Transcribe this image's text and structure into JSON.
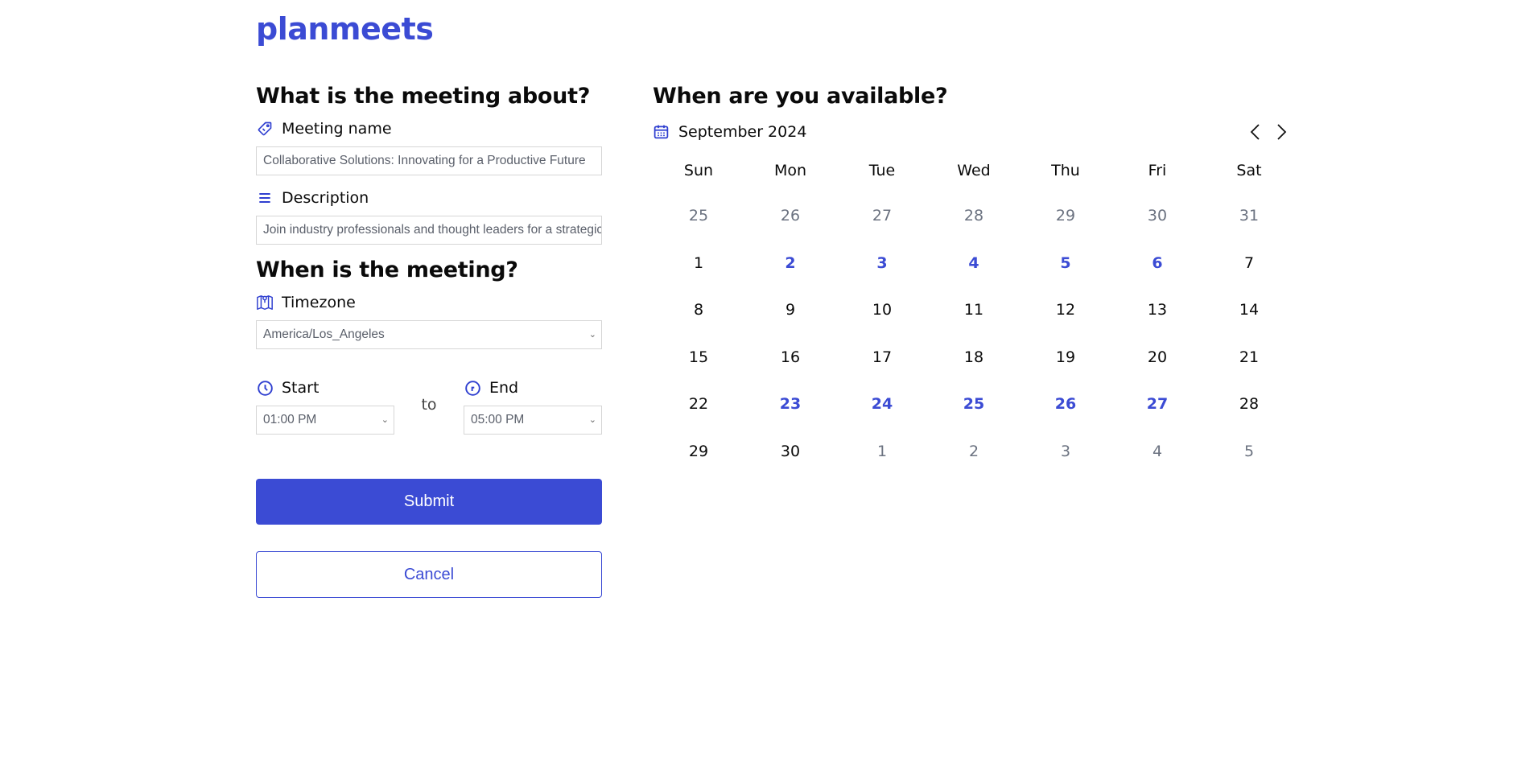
{
  "brand": "planmeets",
  "colors": {
    "accent": "#3b4bd4",
    "muted": "#6b7280",
    "border": "#d6d6d6"
  },
  "about": {
    "title": "What is the meeting about?",
    "meeting_name": {
      "label": "Meeting name",
      "icon": "tag-icon",
      "value": "Collaborative Solutions: Innovating for a Productive Future"
    },
    "description": {
      "label": "Description",
      "icon": "menu-lines-icon",
      "value": "Join industry professionals and thought leaders for a strategic"
    }
  },
  "when": {
    "title": "When is the meeting?",
    "timezone": {
      "label": "Timezone",
      "icon": "map-pin-icon",
      "value": "America/Los_Angeles"
    },
    "start": {
      "label": "Start",
      "icon": "clock-icon",
      "value": "01:00 PM"
    },
    "separator": "to",
    "end": {
      "label": "End",
      "icon": "clock-icon",
      "value": "05:00 PM"
    }
  },
  "actions": {
    "submit": "Submit",
    "cancel": "Cancel"
  },
  "availability": {
    "title": "When are you available?",
    "month_label": "September 2024",
    "weekdays": [
      "Sun",
      "Mon",
      "Tue",
      "Wed",
      "Thu",
      "Fri",
      "Sat"
    ],
    "weeks": [
      [
        {
          "d": "25",
          "s": "other"
        },
        {
          "d": "26",
          "s": "other"
        },
        {
          "d": "27",
          "s": "other"
        },
        {
          "d": "28",
          "s": "other"
        },
        {
          "d": "29",
          "s": "other"
        },
        {
          "d": "30",
          "s": "other"
        },
        {
          "d": "31",
          "s": "other"
        }
      ],
      [
        {
          "d": "1",
          "s": "cur"
        },
        {
          "d": "2",
          "s": "sel"
        },
        {
          "d": "3",
          "s": "sel"
        },
        {
          "d": "4",
          "s": "sel"
        },
        {
          "d": "5",
          "s": "sel"
        },
        {
          "d": "6",
          "s": "sel"
        },
        {
          "d": "7",
          "s": "cur"
        }
      ],
      [
        {
          "d": "8",
          "s": "cur"
        },
        {
          "d": "9",
          "s": "cur"
        },
        {
          "d": "10",
          "s": "cur"
        },
        {
          "d": "11",
          "s": "cur"
        },
        {
          "d": "12",
          "s": "cur"
        },
        {
          "d": "13",
          "s": "cur"
        },
        {
          "d": "14",
          "s": "cur"
        }
      ],
      [
        {
          "d": "15",
          "s": "cur"
        },
        {
          "d": "16",
          "s": "cur"
        },
        {
          "d": "17",
          "s": "cur"
        },
        {
          "d": "18",
          "s": "cur"
        },
        {
          "d": "19",
          "s": "cur"
        },
        {
          "d": "20",
          "s": "cur"
        },
        {
          "d": "21",
          "s": "cur"
        }
      ],
      [
        {
          "d": "22",
          "s": "cur"
        },
        {
          "d": "23",
          "s": "sel"
        },
        {
          "d": "24",
          "s": "sel"
        },
        {
          "d": "25",
          "s": "sel"
        },
        {
          "d": "26",
          "s": "sel"
        },
        {
          "d": "27",
          "s": "sel"
        },
        {
          "d": "28",
          "s": "cur"
        }
      ],
      [
        {
          "d": "29",
          "s": "cur"
        },
        {
          "d": "30",
          "s": "cur"
        },
        {
          "d": "1",
          "s": "other"
        },
        {
          "d": "2",
          "s": "other"
        },
        {
          "d": "3",
          "s": "other"
        },
        {
          "d": "4",
          "s": "other"
        },
        {
          "d": "5",
          "s": "other"
        }
      ]
    ]
  }
}
